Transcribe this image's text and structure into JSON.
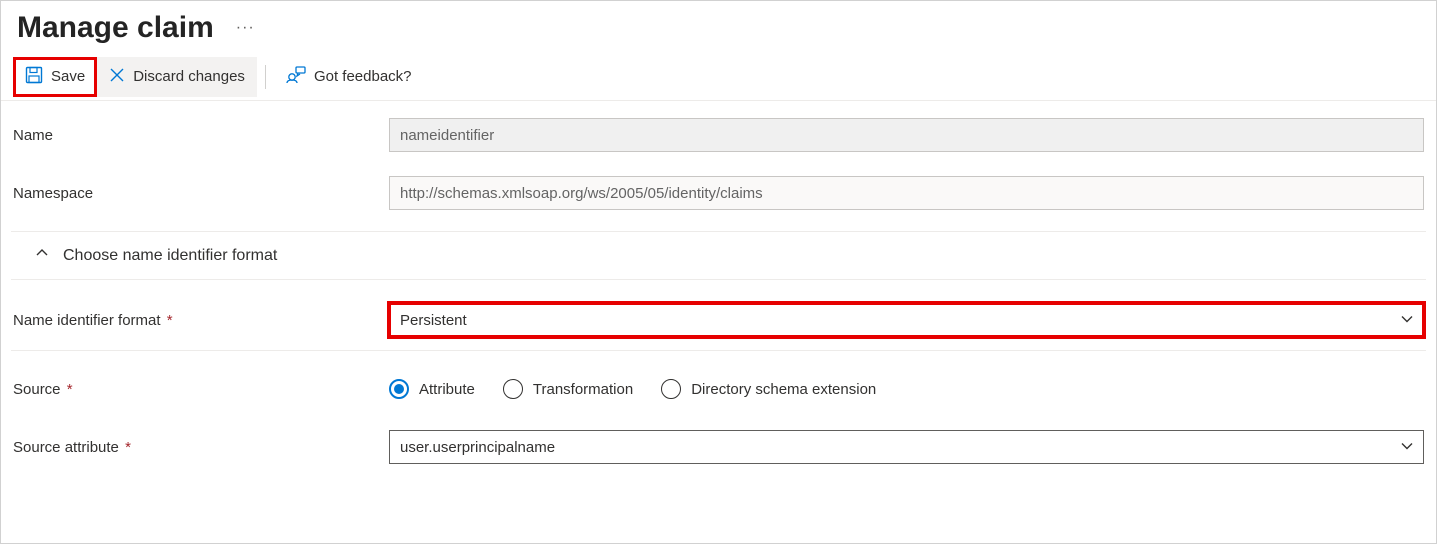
{
  "header": {
    "title": "Manage claim",
    "overflow": "···"
  },
  "toolbar": {
    "save_label": "Save",
    "discard_label": "Discard changes",
    "feedback_label": "Got feedback?"
  },
  "form": {
    "name_label": "Name",
    "name_value": "nameidentifier",
    "namespace_label": "Namespace",
    "namespace_value": "http://schemas.xmlsoap.org/ws/2005/05/identity/claims",
    "section_label": "Choose name identifier format",
    "format_label": "Name identifier format",
    "format_value": "Persistent",
    "source_label": "Source",
    "source_options": {
      "attribute": "Attribute",
      "transformation": "Transformation",
      "directory": "Directory schema extension"
    },
    "source_selected": "attribute",
    "source_attribute_label": "Source attribute",
    "source_attribute_value": "user.userprincipalname"
  },
  "glyphs": {
    "required": "*"
  }
}
